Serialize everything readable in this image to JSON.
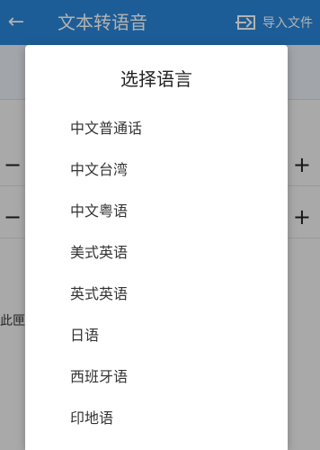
{
  "app": {
    "title": "文本转语音",
    "back_icon": "arrow-left-icon",
    "import_label": "导入文件",
    "import_icon": "import-file-icon",
    "primary_color": "#2a86d8"
  },
  "background": {
    "left_text": "此匣子"
  },
  "dialog": {
    "title": "选择语言",
    "options": [
      "中文普通话",
      "中文台湾",
      "中文粤语",
      "美式英语",
      "英式英语",
      "日语",
      "西班牙语",
      "印地语"
    ]
  }
}
